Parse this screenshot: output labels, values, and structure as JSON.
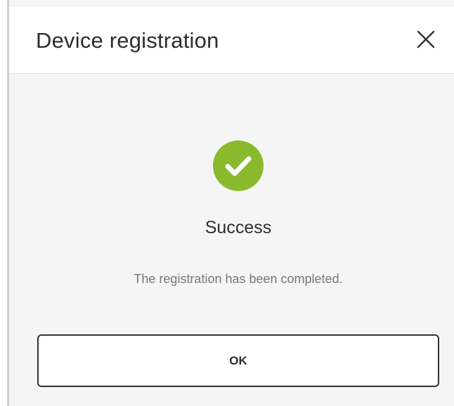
{
  "dialog": {
    "title": "Device registration",
    "close_icon": "close-icon",
    "status_icon": "check-circle-icon",
    "status_color": "#8ab92d",
    "heading": "Success",
    "message": "The registration has been completed.",
    "ok_label": "OK"
  }
}
